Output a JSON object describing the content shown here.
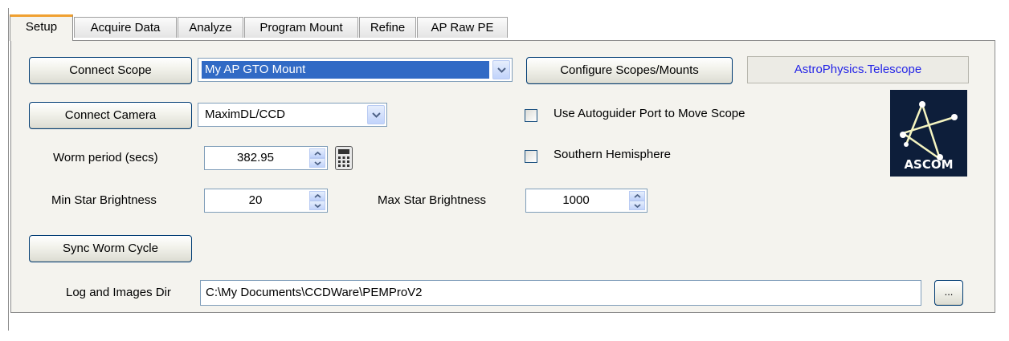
{
  "tabs": [
    {
      "label": "Setup",
      "active": true
    },
    {
      "label": "Acquire Data",
      "active": false
    },
    {
      "label": "Analyze",
      "active": false
    },
    {
      "label": "Program Mount",
      "active": false
    },
    {
      "label": "Refine",
      "active": false
    },
    {
      "label": "AP Raw PE",
      "active": false
    }
  ],
  "setup": {
    "connect_scope_label": "Connect Scope",
    "scope_selected": "My AP GTO Mount",
    "configure_label": "Configure Scopes/Mounts",
    "driver_id": "AstroPhysics.Telescope",
    "connect_camera_label": "Connect Camera",
    "camera_selected": "MaximDL/CCD",
    "autoguider_label": "Use Autoguider Port to Move Scope",
    "autoguider_checked": false,
    "worm_label": "Worm period (secs)",
    "worm_value": "382.95",
    "southern_label": "Southern Hemisphere",
    "southern_checked": false,
    "min_star_label": "Min Star Brightness",
    "min_star_value": "20",
    "max_star_label": "Max Star Brightness",
    "max_star_value": "1000",
    "sync_label": "Sync Worm Cycle",
    "log_dir_label": "Log and Images Dir",
    "log_dir_value": "C:\\My Documents\\CCDWare\\PEMProV2",
    "browse_label": "...",
    "logo_text": "ASCOM"
  },
  "colors": {
    "accent_tab": "#f0a030",
    "selection": "#316ac5",
    "driver_text": "#2424e6",
    "logo_bg": "#0d1e3a"
  },
  "icons": [
    "dropdown-arrow-icon",
    "spin-up-icon",
    "spin-down-icon",
    "calculator-icon",
    "ascom-logo"
  ]
}
